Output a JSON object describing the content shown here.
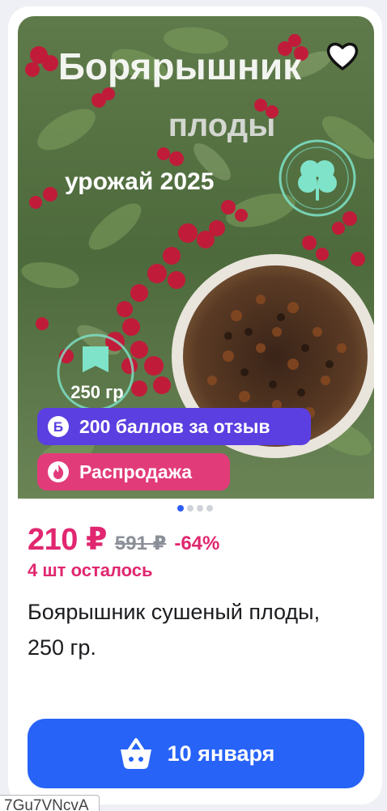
{
  "image": {
    "title_line1": "Борярышник",
    "title_line2": "плоды",
    "harvest": "урожай 2025",
    "weight": "250 гр"
  },
  "badges": {
    "bonus": "200 баллов за отзыв",
    "bonus_letter": "Б",
    "sale": "Распродажа"
  },
  "carousel": {
    "count": 4,
    "active": 1
  },
  "price": {
    "current": "210 ₽",
    "old": "591 ₽",
    "discount": "-64%"
  },
  "stock": "4 шт осталось",
  "product_title": "Боярышник сушеный плоды, 250 гр.",
  "cart": {
    "label": "10 января",
    "icon": "basket-icon"
  },
  "tooltip": "7Gu7VNcvA",
  "colors": {
    "accent_price": "#e0276f",
    "button": "#2763f7",
    "bonus_badge": "#5b3fe0",
    "sale_badge": "#e23b7a"
  }
}
